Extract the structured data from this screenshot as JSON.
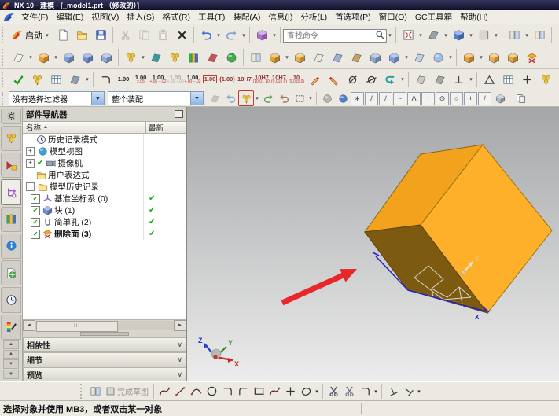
{
  "icons": {
    "dropdown": "▾",
    "down": "▼",
    "up": "▲",
    "left": "◄",
    "right": "►",
    "check": "✔",
    "sort_asc": "▲",
    "chevron": "∨",
    "plus": "+",
    "minus": "−",
    "grip_texture": "III"
  },
  "titlebar": {
    "title": "NX 10 - 建模 - [_model1.prt （修改的）]"
  },
  "menubar": {
    "items": [
      {
        "label": "文件(F)"
      },
      {
        "label": "编辑(E)"
      },
      {
        "label": "视图(V)"
      },
      {
        "label": "插入(S)"
      },
      {
        "label": "格式(R)"
      },
      {
        "label": "工具(T)"
      },
      {
        "label": "装配(A)"
      },
      {
        "label": "信息(I)"
      },
      {
        "label": "分析(L)"
      },
      {
        "label": "首选项(P)"
      },
      {
        "label": "窗口(O)"
      },
      {
        "label": "GC工具箱"
      },
      {
        "label": "帮助(H)"
      }
    ]
  },
  "toolbar_standard": {
    "start_label": "启动",
    "find_placeholder": "查找命令"
  },
  "toolbar_dimension": {
    "buttons": [
      {
        "main": "1.00",
        "sub": ""
      },
      {
        "main": "1.00",
        "sub": "±.05"
      },
      {
        "main": "1.00",
        "sub": "+.05 −.02"
      },
      {
        "main": "1.00",
        "sub": "+.05 −.00"
      },
      {
        "main": "1.00",
        "sub": "+.00 −.02"
      },
      {
        "main": "1.00",
        "sub": ""
      },
      {
        "main": "(1.00)",
        "sub": ""
      },
      {
        "main": "10H7",
        "sub": ""
      },
      {
        "main": "10H7",
        "sub": "(10.01 10)"
      },
      {
        "main": "10H7",
        "sub": "(0.015 0)"
      },
      {
        "main": "10",
        "sub": "(0.015 0)"
      }
    ]
  },
  "selection_bar": {
    "filter": "没有选择过滤器",
    "scope": "整个装配",
    "snap_glyphs": [
      "∗",
      "/",
      "/",
      "~",
      "Λ",
      "↑",
      "⊙",
      "○",
      "+",
      "/"
    ]
  },
  "navigator": {
    "title": "部件导航器",
    "col_name": "名称",
    "col_latest": "最新",
    "tree": [
      {
        "label": "历史记录模式",
        "latest": ""
      },
      {
        "label": "模型视图",
        "latest": ""
      },
      {
        "label": "摄像机",
        "latest": ""
      },
      {
        "label": "用户表达式",
        "latest": ""
      },
      {
        "label": "模型历史记录",
        "latest": ""
      },
      {
        "label": "基准坐标系 (0)",
        "latest": "✔"
      },
      {
        "label": "块 (1)",
        "latest": "✔"
      },
      {
        "label": "简单孔 (2)",
        "latest": "✔"
      },
      {
        "label": "删除面 (3)",
        "latest": "✔"
      }
    ],
    "sections": [
      {
        "label": "相依性"
      },
      {
        "label": "细节"
      },
      {
        "label": "预览"
      }
    ]
  },
  "sketch_toolbar": {
    "finish_label": "完成草图"
  },
  "statusbar": {
    "message": "选择对象并使用 MB3，或者双击某一对象"
  },
  "viewport": {
    "triad": {
      "x": "X",
      "y": "Y",
      "z": "Z"
    },
    "sketch_axis_x": "X",
    "face_axis_y": "Y",
    "cube_colors": {
      "top": "#F2A21C",
      "right": "#FFB02A",
      "shadow": "#7C5A10"
    },
    "annotation_color": "#E8272B"
  }
}
